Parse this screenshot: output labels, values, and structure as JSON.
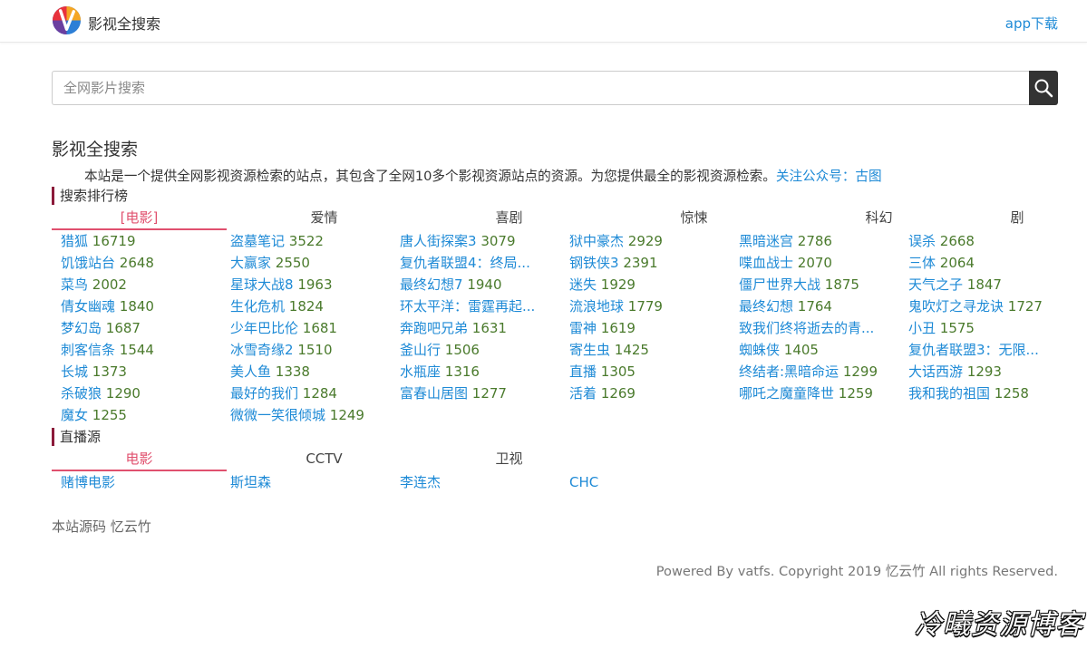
{
  "header": {
    "site_name": "影视全搜索",
    "app_link": "app下载",
    "logo_colors": [
      "#e8323c",
      "#f5a623",
      "#2d7fd6",
      "#6b3fa0"
    ]
  },
  "search": {
    "placeholder": "全网影片搜索",
    "button_icon": "search-icon"
  },
  "main": {
    "title": "影视全搜索",
    "intro_text": "本站是一个提供全网影视资源检索的站点，其包含了全网10多个影视资源站点的资源。为您提供最全的影视资源检索。",
    "intro_link": "关注公众号：古图"
  },
  "ranking": {
    "title": "搜索排行榜",
    "tabs": [
      {
        "label": "[电影]",
        "active": true
      },
      {
        "label": "爱情",
        "active": false
      },
      {
        "label": "喜剧",
        "active": false
      },
      {
        "label": "惊悚",
        "active": false
      },
      {
        "label": "科幻",
        "active": false
      },
      {
        "label": "剧",
        "active": false
      }
    ],
    "items": [
      {
        "title": "猎狐",
        "count": "16719"
      },
      {
        "title": "盗墓笔记",
        "count": "3522"
      },
      {
        "title": "唐人街探案3",
        "count": "3079"
      },
      {
        "title": "狱中豪杰",
        "count": "2929"
      },
      {
        "title": "黑暗迷宫",
        "count": "2786"
      },
      {
        "title": "误杀",
        "count": "2668"
      },
      {
        "title": "饥饿站台",
        "count": "2648"
      },
      {
        "title": "大赢家",
        "count": "2550"
      },
      {
        "title": "复仇者联盟4：终局...",
        "count": ""
      },
      {
        "title": "钢铁侠3",
        "count": "2391"
      },
      {
        "title": "喋血战士",
        "count": "2070"
      },
      {
        "title": "三体",
        "count": "2064"
      },
      {
        "title": "菜鸟",
        "count": "2002"
      },
      {
        "title": "星球大战8",
        "count": "1963"
      },
      {
        "title": "最终幻想7",
        "count": "1940"
      },
      {
        "title": "迷失",
        "count": "1929"
      },
      {
        "title": "僵尸世界大战",
        "count": "1875"
      },
      {
        "title": "天气之子",
        "count": "1847"
      },
      {
        "title": "倩女幽魂",
        "count": "1840"
      },
      {
        "title": "生化危机",
        "count": "1824"
      },
      {
        "title": "环太平洋：雷霆再起...",
        "count": ""
      },
      {
        "title": "流浪地球",
        "count": "1779"
      },
      {
        "title": "最终幻想",
        "count": "1764"
      },
      {
        "title": "鬼吹灯之寻龙诀",
        "count": "1727"
      },
      {
        "title": "梦幻岛",
        "count": "1687"
      },
      {
        "title": "少年巴比伦",
        "count": "1681"
      },
      {
        "title": "奔跑吧兄弟",
        "count": "1631"
      },
      {
        "title": "雷神",
        "count": "1619"
      },
      {
        "title": "致我们终将逝去的青...",
        "count": ""
      },
      {
        "title": "小丑",
        "count": "1575"
      },
      {
        "title": "刺客信条",
        "count": "1544"
      },
      {
        "title": "冰雪奇缘2",
        "count": "1510"
      },
      {
        "title": "釜山行",
        "count": "1506"
      },
      {
        "title": "寄生虫",
        "count": "1425"
      },
      {
        "title": "蜘蛛侠",
        "count": "1405"
      },
      {
        "title": "复仇者联盟3：无限...",
        "count": ""
      },
      {
        "title": "长城",
        "count": "1373"
      },
      {
        "title": "美人鱼",
        "count": "1338"
      },
      {
        "title": "水瓶座",
        "count": "1316"
      },
      {
        "title": "直播",
        "count": "1305"
      },
      {
        "title": "终结者:黑暗命运",
        "count": "1299"
      },
      {
        "title": "大话西游",
        "count": "1293"
      },
      {
        "title": "杀破狼",
        "count": "1290"
      },
      {
        "title": "最好的我们",
        "count": "1284"
      },
      {
        "title": "富春山居图",
        "count": "1277"
      },
      {
        "title": "活着",
        "count": "1269"
      },
      {
        "title": "哪吒之魔童降世",
        "count": "1259"
      },
      {
        "title": "我和我的祖国",
        "count": "1258"
      },
      {
        "title": "魔女",
        "count": "1255"
      },
      {
        "title": "微微一笑很倾城",
        "count": "1249"
      }
    ]
  },
  "live": {
    "title": "直播源",
    "tabs": [
      {
        "label": "电影",
        "active": true
      },
      {
        "label": "CCTV",
        "active": false
      },
      {
        "label": "卫视",
        "active": false
      }
    ],
    "items": [
      {
        "title": "赌博电影",
        "count": ""
      },
      {
        "title": "斯坦森",
        "count": ""
      },
      {
        "title": "李连杰",
        "count": ""
      },
      {
        "title": "CHC",
        "count": ""
      }
    ]
  },
  "source_text": "本站源码 忆云竹",
  "footer_text": "Powered By vatfs. Copyright 2019 忆云竹 All rights Reserved.",
  "watermark": "冷曦资源博客",
  "colors": {
    "link": "#1e8ad6",
    "count": "#4a7a2c",
    "active_tab": "#e0506e",
    "section_bar": "#8b1a3a"
  }
}
